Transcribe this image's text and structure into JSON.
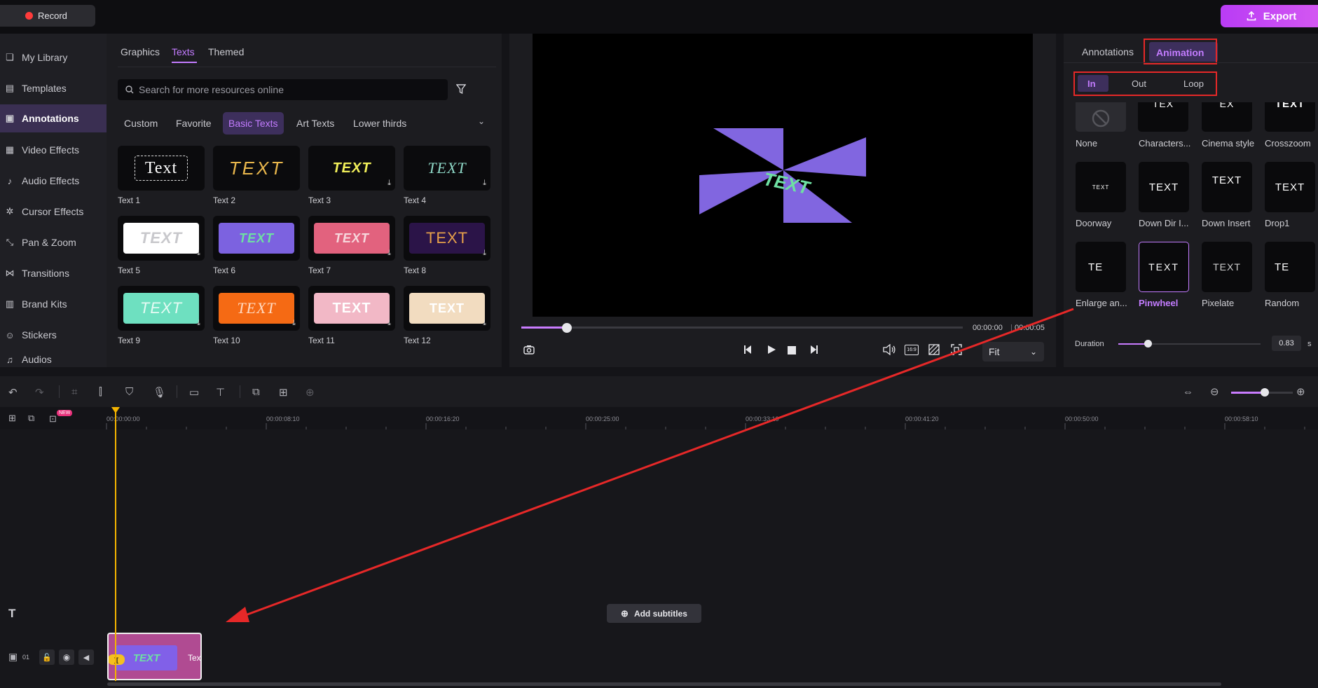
{
  "topbar": {
    "record_label": "Record",
    "export_label": "Export"
  },
  "sidebar": {
    "items": [
      {
        "label": "My Library",
        "icon": "layers-icon"
      },
      {
        "label": "Templates",
        "icon": "template-icon"
      },
      {
        "label": "Annotations",
        "icon": "annotation-icon"
      },
      {
        "label": "Video Effects",
        "icon": "video-effects-icon"
      },
      {
        "label": "Audio Effects",
        "icon": "audio-effects-icon"
      },
      {
        "label": "Cursor Effects",
        "icon": "cursor-icon"
      },
      {
        "label": "Pan & Zoom",
        "icon": "pan-zoom-icon"
      },
      {
        "label": "Transitions",
        "icon": "transitions-icon"
      },
      {
        "label": "Brand Kits",
        "icon": "brand-kit-icon"
      },
      {
        "label": "Stickers",
        "icon": "sticker-icon"
      },
      {
        "label": "Audios",
        "icon": "audio-icon"
      }
    ],
    "active": "Annotations"
  },
  "resources": {
    "tabs": [
      "Graphics",
      "Texts",
      "Themed"
    ],
    "active_tab": "Texts",
    "search_placeholder": "Search for more resources online",
    "subtabs": [
      "Custom",
      "Favorite",
      "Basic Texts",
      "Art Texts",
      "Lower thirds"
    ],
    "active_subtab": "Basic Texts",
    "tiles": [
      {
        "label": "Text 1",
        "preview": "Text"
      },
      {
        "label": "Text 2",
        "preview": "TEXT"
      },
      {
        "label": "Text 3",
        "preview": "TEXT"
      },
      {
        "label": "Text 4",
        "preview": "TEXT"
      },
      {
        "label": "Text 5",
        "preview": "TEXT"
      },
      {
        "label": "Text 6",
        "preview": "TEXT"
      },
      {
        "label": "Text 7",
        "preview": "TEXT"
      },
      {
        "label": "Text 8",
        "preview": "TEXT"
      },
      {
        "label": "Text 9",
        "preview": "TEXT"
      },
      {
        "label": "Text 10",
        "preview": "TEXT"
      },
      {
        "label": "Text 11",
        "preview": "TEXT"
      },
      {
        "label": "Text 12",
        "preview": "TEXT"
      }
    ]
  },
  "preview": {
    "canvas_text": "TEXT",
    "time_current": "00:00:00",
    "time_total": "00:00:05",
    "progress": 0.09,
    "fit_label": "Fit",
    "aspect_label": "16:9"
  },
  "animation_panel": {
    "tabs": [
      "Annotations",
      "Animation"
    ],
    "active_tab": "Animation",
    "subtabs": [
      "In",
      "Out",
      "Loop"
    ],
    "active_subtab": "In",
    "effects": [
      {
        "label": "None",
        "preview": ""
      },
      {
        "label": "Characters...",
        "preview": "TEX"
      },
      {
        "label": "Cinema style",
        "preview": "EX"
      },
      {
        "label": "Crosszoom",
        "preview": "TEXT"
      },
      {
        "label": "Doorway",
        "preview": "TEXT"
      },
      {
        "label": "Down Dir I...",
        "preview": "TEXT"
      },
      {
        "label": "Down Insert",
        "preview": "TEXT"
      },
      {
        "label": "Drop1",
        "preview": "TEXT"
      },
      {
        "label": "Enlarge an...",
        "preview": "TE"
      },
      {
        "label": "Pinwheel",
        "preview": "TEXT"
      },
      {
        "label": "Pixelate",
        "preview": "TEXT"
      },
      {
        "label": "Random",
        "preview": "TE"
      }
    ],
    "selected_effect": "Pinwheel",
    "duration_label": "Duration",
    "duration_value": "0.83",
    "duration_unit": "s",
    "duration_fraction": 0.2
  },
  "timeline": {
    "ruler_labels": [
      "00:00:00:00",
      "00:00:08:10",
      "00:00:16:20",
      "00:00:25:00",
      "00:00:33:10",
      "00:00:41:20",
      "00:00:50:00",
      "00:00:58:10"
    ],
    "new_badge": "NEW",
    "add_subtitles_label": "Add subtitles",
    "track_number": "01",
    "clip_preview": "TEXT",
    "clip_label": "Tex",
    "clip_badge": "][",
    "zoom_fraction": 0.5
  },
  "colors": {
    "accent": "#c37cff",
    "export_gradient": "#c346f4",
    "annotation_red": "#e62828",
    "playhead": "#f4b400"
  }
}
